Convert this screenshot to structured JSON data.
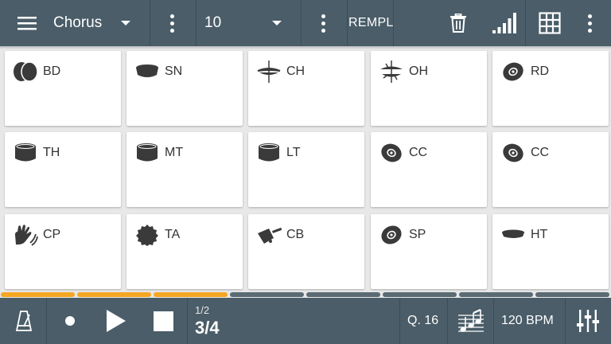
{
  "toolbar": {
    "pattern": "Chorus",
    "steps": "10",
    "replace_label": "REMPL",
    "icons": [
      "menu-icon",
      "chevron-down-icon",
      "more-vert-icon",
      "trash-icon",
      "signal-icon",
      "grid-icon"
    ]
  },
  "pads": [
    {
      "label": "BD",
      "icon": "bass-drum-icon"
    },
    {
      "label": "SN",
      "icon": "snare-icon"
    },
    {
      "label": "CH",
      "icon": "closed-hihat-icon"
    },
    {
      "label": "OH",
      "icon": "open-hihat-icon"
    },
    {
      "label": "RD",
      "icon": "ride-cymbal-icon"
    },
    {
      "label": "TH",
      "icon": "tom-icon"
    },
    {
      "label": "MT",
      "icon": "tom-icon"
    },
    {
      "label": "LT",
      "icon": "tom-icon"
    },
    {
      "label": "CC",
      "icon": "crash-cymbal-icon"
    },
    {
      "label": "CC",
      "icon": "crash-cymbal-icon"
    },
    {
      "label": "CP",
      "icon": "clap-icon"
    },
    {
      "label": "TA",
      "icon": "tambourine-icon"
    },
    {
      "label": "CB",
      "icon": "cowbell-icon"
    },
    {
      "label": "SP",
      "icon": "splash-cymbal-icon"
    },
    {
      "label": "HT",
      "icon": "high-tom-icon"
    }
  ],
  "progress": {
    "segments": 8,
    "active_segments": 3
  },
  "transport": {
    "bar_fraction": "1/2",
    "beat": "3/4",
    "quantize": "Q. 16",
    "bpm": "120 BPM",
    "icons": [
      "metronome-icon",
      "record-icon",
      "play-icon",
      "stop-icon",
      "notes-icon",
      "mixer-icon"
    ]
  },
  "colors": {
    "bar": "#4a5d68",
    "active": "#f5a623",
    "inactive": "#5a6b74",
    "icon": "#3a3a3a"
  }
}
